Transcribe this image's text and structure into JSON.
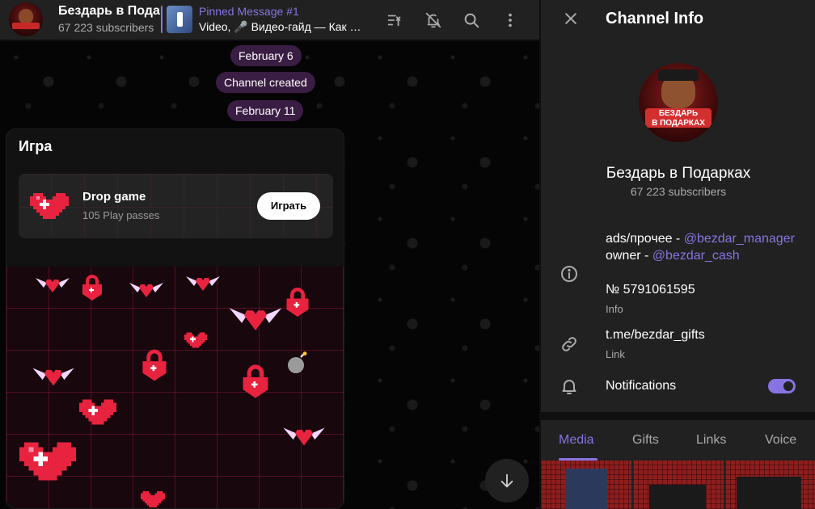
{
  "header": {
    "title": "Бездарь в Подарках",
    "subscribers": "67 223 subscribers",
    "pinned_title": "Pinned Message #1",
    "pinned_text": "Video, 🎤 Видео-гайд — Как …"
  },
  "chat": {
    "dates": [
      "February 6",
      "Channel created",
      "February 11"
    ],
    "game": {
      "heading": "Игра",
      "name": "Drop game",
      "passes": "105 Play passes",
      "play_label": "Играть"
    }
  },
  "info": {
    "title": "Channel Info",
    "avatar_banner": [
      "БЕЗДАРЬ",
      "В ПОДАРКАХ"
    ],
    "channel_name": "Бездарь в Подарках",
    "subscribers": "67 223 subscribers",
    "desc_line1_prefix": "ads/прочее - ",
    "desc_line1_link": "@bezdar_manager",
    "desc_line2_prefix": "owner - ",
    "desc_line2_link": "@bezdar_cash",
    "id_value": "№ 5791061595",
    "id_label": "Info",
    "link_value": "t.me/bezdar_gifts",
    "link_label": "Link",
    "notifications_label": "Notifications",
    "notifications_on": true
  },
  "tabs": [
    {
      "label": "Media",
      "active": true
    },
    {
      "label": "Gifts",
      "active": false
    },
    {
      "label": "Links",
      "active": false
    },
    {
      "label": "Voice",
      "active": false
    }
  ],
  "colors": {
    "accent": "#8774e1",
    "date_pill": "#3a1d42",
    "panel_bg": "#212121",
    "heart_red": "#e8233f"
  },
  "icons": [
    "pin-list-icon",
    "mute-bell-icon",
    "search-icon",
    "more-vert-icon",
    "close-icon",
    "info-circle-icon",
    "link-icon",
    "bell-icon",
    "arrow-down-icon"
  ]
}
